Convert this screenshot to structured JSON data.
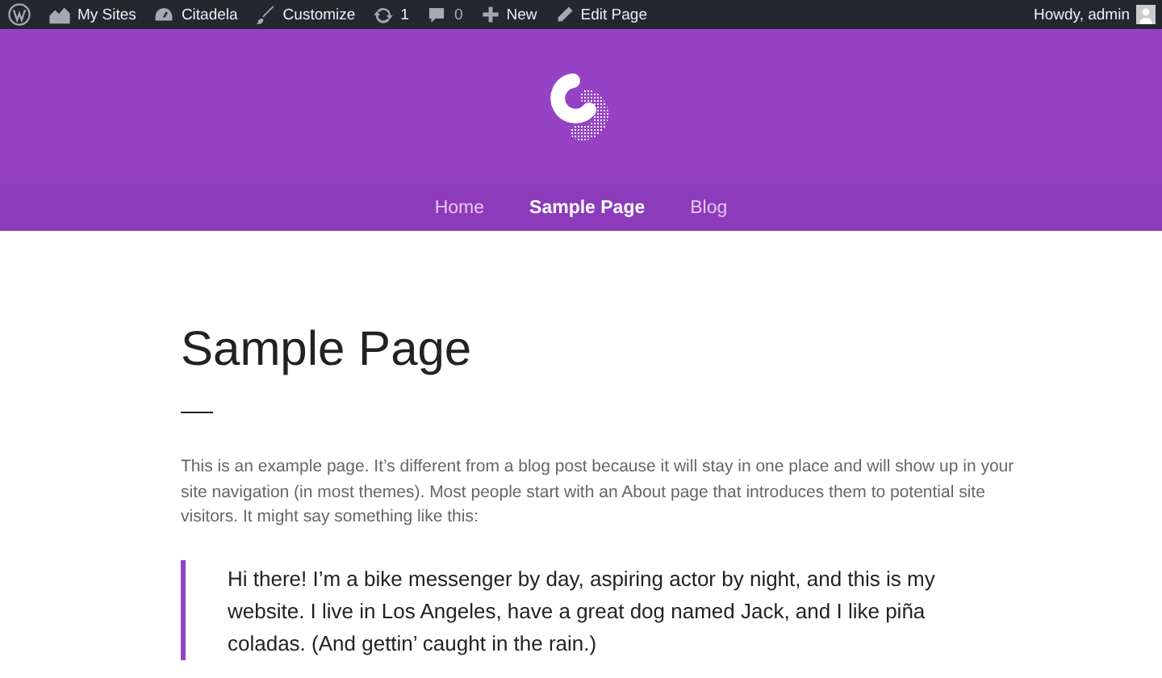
{
  "admin_bar": {
    "items": [
      {
        "kind": "logo"
      },
      {
        "kind": "sites",
        "label": "My Sites"
      },
      {
        "kind": "dashboard",
        "label": "Citadela"
      },
      {
        "kind": "customize",
        "label": "Customize"
      },
      {
        "kind": "updates",
        "label": "1"
      },
      {
        "kind": "comments",
        "label": "0"
      },
      {
        "kind": "new",
        "label": "New"
      },
      {
        "kind": "edit",
        "label": "Edit Page"
      }
    ],
    "account": "Howdy, admin"
  },
  "nav": [
    {
      "label": "Home",
      "selected": false
    },
    {
      "label": "Sample Page",
      "selected": true
    },
    {
      "label": "Blog",
      "selected": false
    }
  ],
  "page": {
    "title": "Sample Page",
    "intro": "This is an example page. It’s different from a blog post because it will stay in one place and will show up in your site navigation (in most themes). Most people start with an About page that introduces them to potential site visitors. It might say something like this:",
    "quote": "Hi there! I’m a bike messenger by day, aspiring actor by night, and this is my website. I live in Los Angeles, have a great dog named Jack, and I like piña coladas. (And gettin’ caught in the rain.)"
  }
}
